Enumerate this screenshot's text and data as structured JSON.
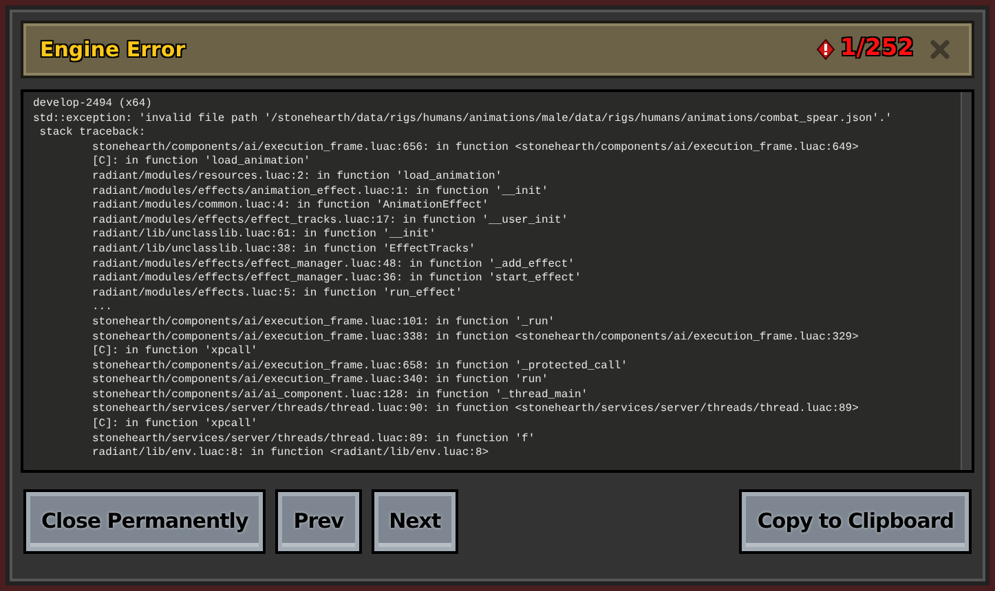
{
  "window": {
    "title": "Engine Error",
    "error_count": "1/252"
  },
  "log": {
    "lines": [
      {
        "kind": "plain",
        "text": "develop-2494 (x64)"
      },
      {
        "kind": "plain",
        "text": "std::exception: 'invalid file path '/stonehearth/data/rigs/humans/animations/male/data/rigs/humans/animations/combat_spear.json'.'"
      },
      {
        "kind": "plain",
        "text": " stack traceback:"
      },
      {
        "kind": "frame",
        "text": "stonehearth/components/ai/execution_frame.luac:656: in function <stonehearth/components/ai/execution_frame.luac:649>"
      },
      {
        "kind": "frame",
        "text": "[C]: in function 'load_animation'"
      },
      {
        "kind": "frame",
        "text": "radiant/modules/resources.luac:2: in function 'load_animation'"
      },
      {
        "kind": "frame",
        "text": "radiant/modules/effects/animation_effect.luac:1: in function '__init'"
      },
      {
        "kind": "frame",
        "text": "radiant/modules/common.luac:4: in function 'AnimationEffect'"
      },
      {
        "kind": "frame",
        "text": "radiant/modules/effects/effect_tracks.luac:17: in function '__user_init'"
      },
      {
        "kind": "frame",
        "text": "radiant/lib/unclasslib.luac:61: in function '__init'"
      },
      {
        "kind": "frame",
        "text": "radiant/lib/unclasslib.luac:38: in function 'EffectTracks'"
      },
      {
        "kind": "frame",
        "text": "radiant/modules/effects/effect_manager.luac:48: in function '_add_effect'"
      },
      {
        "kind": "frame",
        "text": "radiant/modules/effects/effect_manager.luac:36: in function 'start_effect'"
      },
      {
        "kind": "frame",
        "text": "radiant/modules/effects.luac:5: in function 'run_effect'"
      },
      {
        "kind": "frame",
        "text": "..."
      },
      {
        "kind": "frame",
        "text": "stonehearth/components/ai/execution_frame.luac:101: in function '_run'"
      },
      {
        "kind": "frame",
        "text": "stonehearth/components/ai/execution_frame.luac:338: in function <stonehearth/components/ai/execution_frame.luac:329>"
      },
      {
        "kind": "frame",
        "text": "[C]: in function 'xpcall'"
      },
      {
        "kind": "frame",
        "text": "stonehearth/components/ai/execution_frame.luac:658: in function '_protected_call'"
      },
      {
        "kind": "frame",
        "text": "stonehearth/components/ai/execution_frame.luac:340: in function 'run'"
      },
      {
        "kind": "frame",
        "text": "stonehearth/components/ai/ai_component.luac:128: in function '_thread_main'"
      },
      {
        "kind": "frame",
        "text": "stonehearth/services/server/threads/thread.luac:90: in function <stonehearth/services/server/threads/thread.luac:89>"
      },
      {
        "kind": "frame",
        "text": "[C]: in function 'xpcall'"
      },
      {
        "kind": "frame",
        "text": "stonehearth/services/server/threads/thread.luac:89: in function 'f'"
      },
      {
        "kind": "frame",
        "text": "radiant/lib/env.luac:8: in function <radiant/lib/env.luac:8>"
      }
    ]
  },
  "buttons_left": [
    "Close Permanently",
    "Prev",
    "Next"
  ],
  "buttons_right": [
    "Copy to Clipboard"
  ]
}
